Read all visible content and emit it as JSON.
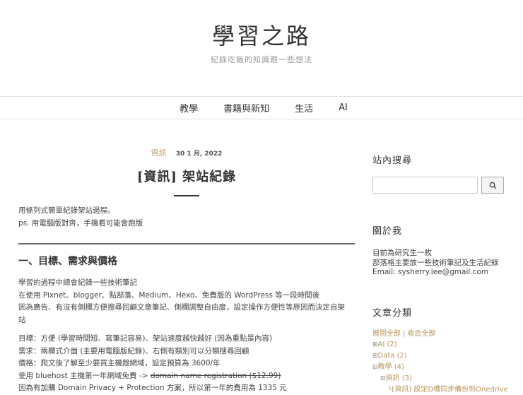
{
  "site": {
    "title": "學習之路",
    "description": "紀錄吃飯的知識跟一些想法"
  },
  "nav": {
    "items": [
      "教學",
      "書籍與新知",
      "生活",
      "AI"
    ]
  },
  "post": {
    "category": "資訊",
    "date": "30 1 月, 2022",
    "title": "[資訊] 架站紀錄",
    "intro": [
      "用條列式簡單紀錄架站過程。",
      "ps. 用電腦版對齊，手機看可能會跑版"
    ],
    "section_heading": "一、目標、需求與價格",
    "para1": [
      "學習的過程中總會紀錄一些技術筆記",
      "在使用 Pixnet、blogger、點部落、Medium、Hexo、免費版的 WordPress 等一段時間後",
      "因為廣告、有沒有側欄方便搜尋回顧文章筆記、側欄調整自由度，設定操作方便性等原因而決定自架",
      "站"
    ],
    "para2": [
      "目標：方便 (學習時間短、寫筆記容易)、架站速度越快越好 (因為重點是內容)",
      "需求：兩欄式介面 (主要用電腦版紀錄)、右側有類別可以分類搜尋回顧",
      "價格：爬文後了解至少要買主機跟網域，設定預算為 3600/年"
    ],
    "bluehost_prefix": "使用 bluehost 主機第一年網域免費 -> ",
    "bluehost_struck": "domain name registration ($12.99)",
    "domain_privacy": "因為有加購 Domain Privacy + Protection 方案，所以第一年的費用為 1335 元"
  },
  "sidebar": {
    "search_title": "站內搜尋",
    "search_placeholder": "",
    "about_title": "關於我",
    "about_lines": [
      "目前為研究生一枚",
      "部落格主要放一些技術筆記及生活紀錄",
      "Email: sysherry.lee@gmail.com"
    ],
    "categories_title": "文章分類",
    "expand_all": "展開全部",
    "collapse_all": "收合全部",
    "tree": [
      {
        "toggle": "⊞",
        "label": "AI (2)"
      },
      {
        "toggle": "⊞",
        "label": "Data (2)"
      },
      {
        "toggle": "⊟",
        "label": "教學 (4)"
      },
      {
        "toggle": "⊟",
        "label": "資訊 (3)"
      },
      {
        "toggle": "",
        "label": "[資訊] 設定D槽同步備份到Onedrive"
      }
    ]
  },
  "icons": {
    "search": "magnifier-icon"
  },
  "colors": {
    "accent": "#b7975e",
    "text": "#333333",
    "border": "#e2e2e2"
  }
}
